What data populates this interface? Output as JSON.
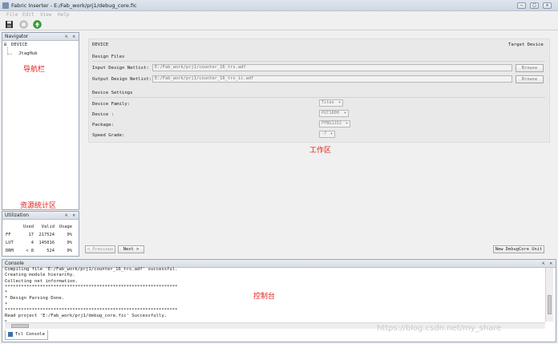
{
  "window": {
    "title": "Fabric Inserter - E:/Fab_work/prj1/debug_core.fic",
    "buttons": {
      "minimize": "–",
      "maximize": "□",
      "close": "✕"
    }
  },
  "menu": [
    "File",
    "Edit",
    "View",
    "Help"
  ],
  "toolbar": {
    "icons": [
      "save-icon",
      "stop-icon",
      "run-icon"
    ]
  },
  "navigator": {
    "title": "Navigator",
    "panel_buttons": "⇱ ✕",
    "tree": {
      "root": "DEVICE",
      "root_toggle": "⊟",
      "child": "JtagHub"
    },
    "annotation": "导航栏"
  },
  "utilization": {
    "title": "Utilization",
    "panel_buttons": "⇱ ✕",
    "annotation": "资源统计区",
    "headers": [
      "",
      "Used",
      "Valid",
      "Usage"
    ],
    "rows": [
      [
        "FF",
        "17",
        "217524",
        "0%"
      ],
      [
        "LUT",
        "4",
        "145016",
        "0%"
      ],
      [
        "DRM",
        "< 8",
        "524",
        "0%"
      ]
    ]
  },
  "workspace": {
    "section": "DEVICE",
    "target": "Target Device",
    "annotation": "工作区",
    "design_files": {
      "heading": "Design Files",
      "input_label": "Input Design Netlist:",
      "input_value": "E:/Fab_work/prj1/counter_16_trs.adf",
      "output_label": "Output Design Netlist:",
      "output_value": "E:/Fab_work/prj1/counter_16_trs_ic.adf",
      "browse_label": "Browse"
    },
    "device_settings": {
      "heading": "Device Settings",
      "family_label": "Device Family:",
      "family_value": "Titan",
      "device_label": "Device :",
      "device_value": "PGT180H",
      "package_label": "Package:",
      "package_value": "FFBG1152",
      "speed_label": "Speed Grade:",
      "speed_value": "-7"
    },
    "nav": {
      "previous": "< Previous",
      "next": "Next >",
      "new_debug": "New DebugCore Unit"
    }
  },
  "console": {
    "title": "Console",
    "panel_buttons": "⇱ ✕",
    "annotation": "控制台",
    "lines": [
      "Compiling file 'E:/Fab_work/prj1/counter_16_trs.adf' successful.",
      "Creating module hierarchy.",
      "Collecting net information.",
      "****************************************************************",
      "*",
      "*  Design Parsing Done.",
      "*",
      "****************************************************************",
      " Read project 'E:/Fab_work/prj1/debug_core.fic' Successfully.",
      "%"
    ],
    "tab": "Tcl Console",
    "watermark": "https://blog.csdn.net/my_share"
  }
}
